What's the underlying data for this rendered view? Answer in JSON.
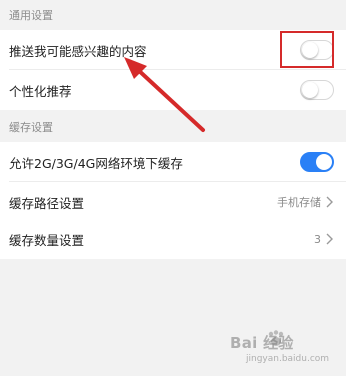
{
  "sections": {
    "general": {
      "title": "通用设置",
      "rows": [
        {
          "label": "推送我可能感兴趣的内容",
          "toggle": "off"
        },
        {
          "label": "个性化推荐",
          "toggle": "off"
        }
      ]
    },
    "cache": {
      "title": "缓存设置",
      "rows": [
        {
          "label": "允许2G/3G/4G网络环境下缓存",
          "toggle": "on"
        },
        {
          "label": "缓存路径设置",
          "value": "手机存储"
        },
        {
          "label": "缓存数量设置",
          "value": "3"
        }
      ]
    }
  },
  "colors": {
    "accent": "#2a80f6",
    "annotation": "#d52a2a"
  },
  "watermark": {
    "brand": "Bai 经验",
    "sub": "jingyan.baidu.com"
  }
}
